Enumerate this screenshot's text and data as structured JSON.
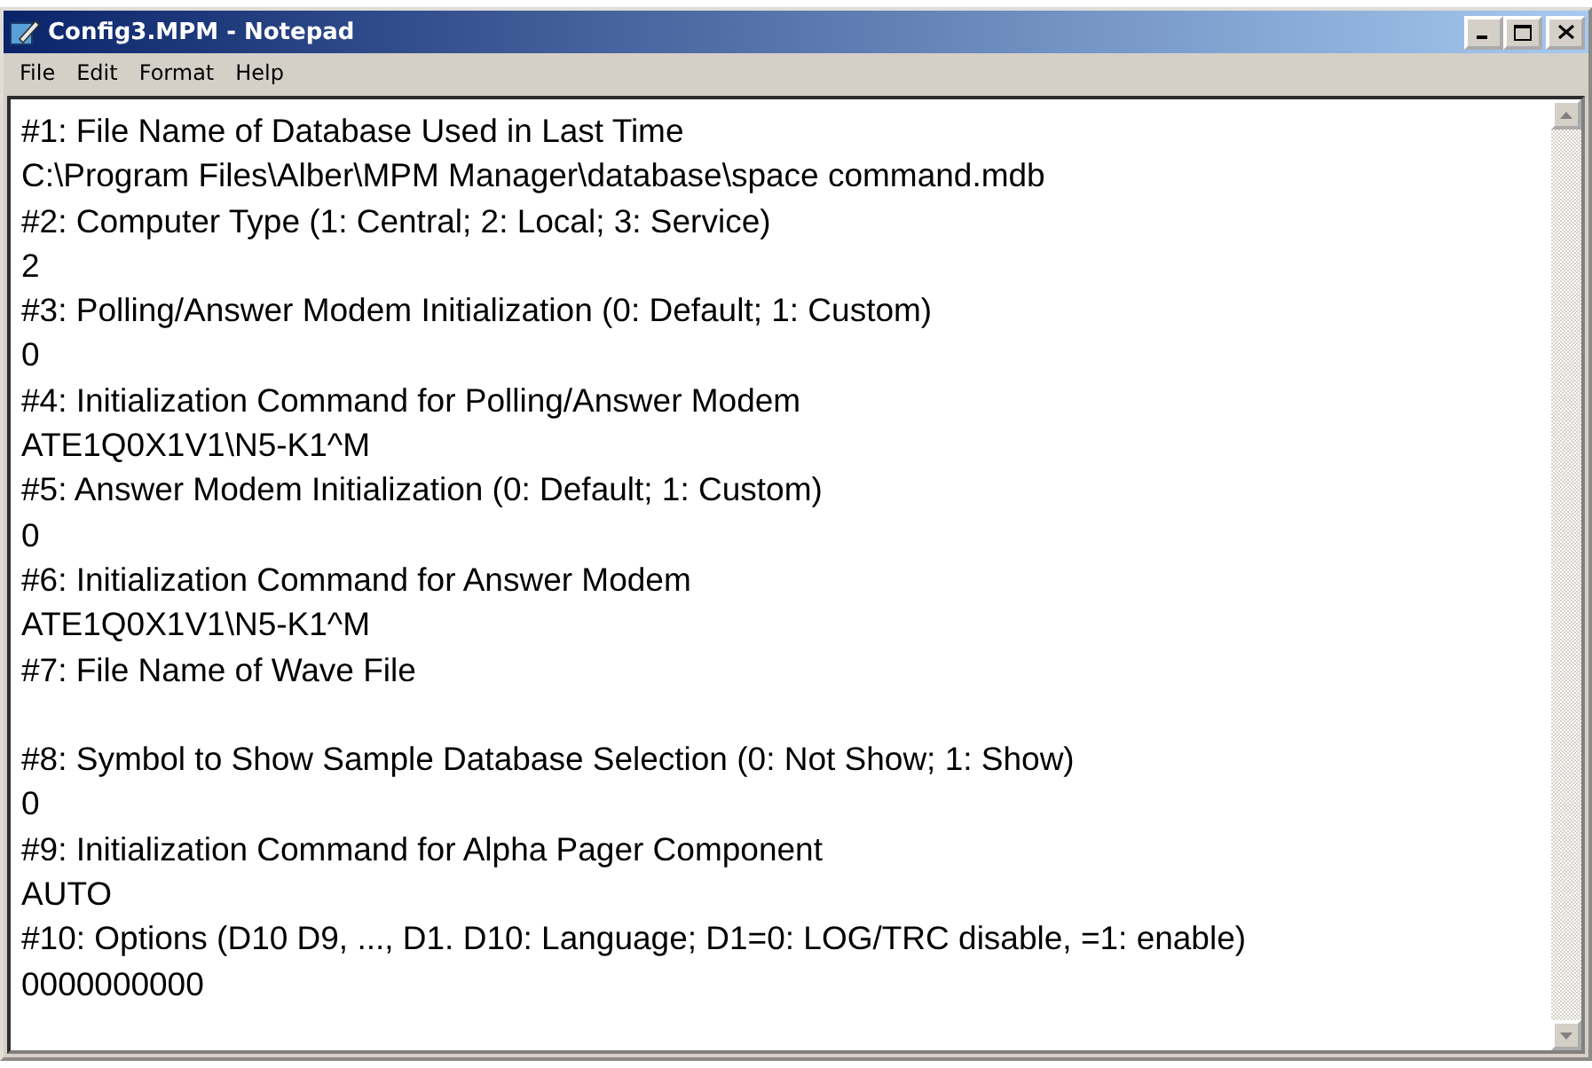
{
  "window": {
    "title": "Config3.MPM - Notepad"
  },
  "menu": [
    "File",
    "Edit",
    "Format",
    "Help"
  ],
  "entries": [
    {
      "heading": "#1: File Name of Database Used in Last Time",
      "value": "C:\\Program Files\\Alber\\MPM Manager\\database\\space command.mdb"
    },
    {
      "heading": "#2: Computer Type (1: Central; 2: Local; 3: Service)",
      "value": "2"
    },
    {
      "heading": "#3: Polling/Answer Modem Initialization (0: Default; 1: Custom)",
      "value": "0"
    },
    {
      "heading": "#4: Initialization Command for Polling/Answer Modem",
      "value": "ATE1Q0X1V1\\N5-K1^M"
    },
    {
      "heading": "#5: Answer Modem Initialization (0: Default; 1: Custom)",
      "value": "0"
    },
    {
      "heading": "#6: Initialization Command for Answer Modem",
      "value": "ATE1Q0X1V1\\N5-K1^M"
    },
    {
      "heading": "#7: File Name of Wave File"
    },
    {
      "heading": "#8: Symbol to Show Sample Database Selection (0: Not Show; 1: Show)",
      "value": "0"
    },
    {
      "heading": "#9: Initialization Command for Alpha Pager Component",
      "value": "AUTO"
    },
    {
      "heading": "#10: Options (D10 D9, ..., D1. D10: Language; D1=0: LOG/TRC disable, =1: enable)",
      "value": "0000000000"
    }
  ]
}
